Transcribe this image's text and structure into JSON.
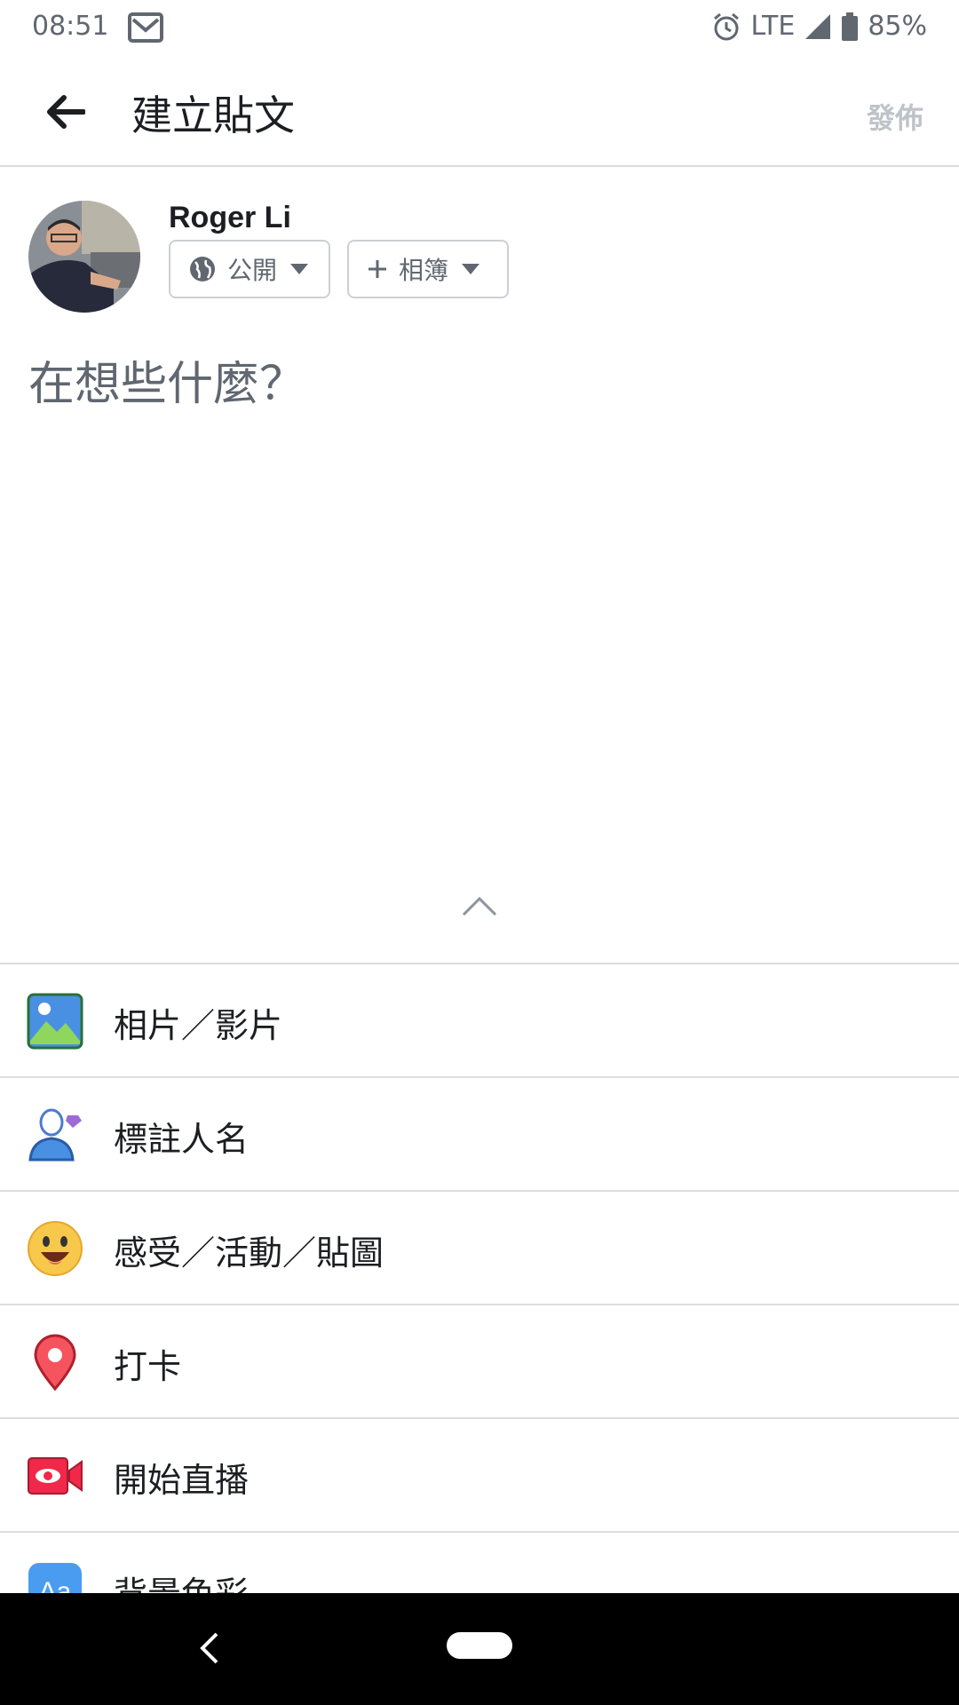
{
  "status_bar": {
    "time": "08:51",
    "network": "LTE",
    "battery": "85%"
  },
  "header": {
    "title": "建立貼文",
    "publish_label": "發佈"
  },
  "profile": {
    "name": "Roger Li",
    "privacy_label": "公開",
    "album_label": "相簿"
  },
  "composer": {
    "placeholder": "在想些什麼？"
  },
  "options": [
    {
      "label": "相片／影片",
      "icon": "photo-video-icon"
    },
    {
      "label": "標註人名",
      "icon": "tag-people-icon"
    },
    {
      "label": "感受／活動／貼圖",
      "icon": "feeling-emoji-icon"
    },
    {
      "label": "打卡",
      "icon": "check-in-pin-icon"
    },
    {
      "label": "開始直播",
      "icon": "live-video-icon"
    },
    {
      "label": "背景色彩",
      "icon": "background-color-icon"
    }
  ],
  "colors": {
    "accent": "#1877f2",
    "muted": "#606770",
    "divider": "#dadde1"
  }
}
